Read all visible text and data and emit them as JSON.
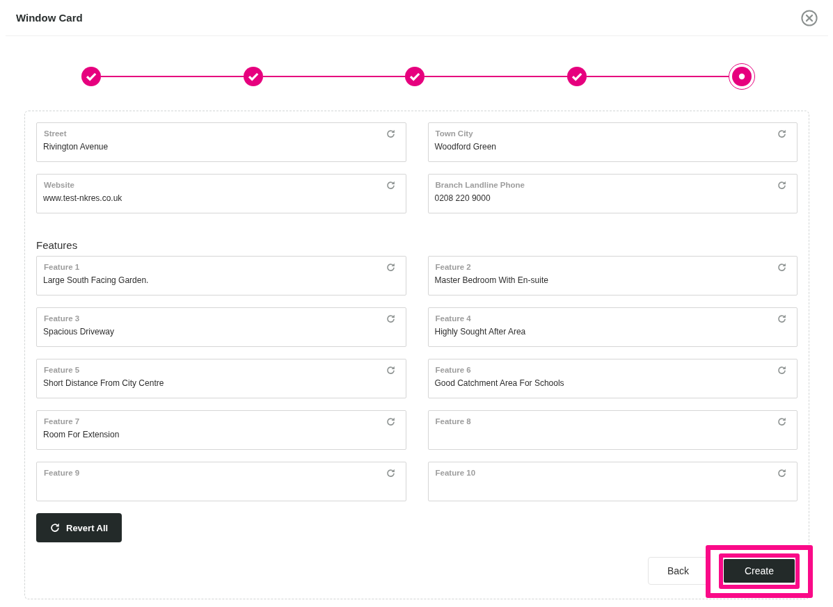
{
  "window": {
    "title": "Window Card"
  },
  "stepper": {
    "steps": [
      {
        "completed": true,
        "selected": false
      },
      {
        "completed": true,
        "selected": false
      },
      {
        "completed": true,
        "selected": false
      },
      {
        "completed": true,
        "selected": false
      },
      {
        "completed": false,
        "selected": true
      }
    ]
  },
  "address_fields": [
    {
      "label": "Street",
      "value": "Rivington Avenue"
    },
    {
      "label": "Town City",
      "value": "Woodford Green"
    },
    {
      "label": "Website",
      "value": "www.test-nkres.co.uk"
    },
    {
      "label": "Branch Landline Phone",
      "value": "0208 220 9000"
    }
  ],
  "features": {
    "heading": "Features",
    "fields": [
      {
        "label": "Feature 1",
        "value": "Large South Facing Garden."
      },
      {
        "label": "Feature 2",
        "value": "Master Bedroom With En-suite"
      },
      {
        "label": "Feature 3",
        "value": "Spacious Driveway"
      },
      {
        "label": "Feature 4",
        "value": "Highly Sought After Area"
      },
      {
        "label": "Feature 5",
        "value": "Short Distance From City Centre"
      },
      {
        "label": "Feature 6",
        "value": "Good Catchment Area For Schools"
      },
      {
        "label": "Feature 7",
        "value": "Room For Extension"
      },
      {
        "label": "Feature 8"
      },
      {
        "label": "Feature 9"
      },
      {
        "label": "Feature 10"
      }
    ]
  },
  "revert_all_button": {
    "label": "Revert All"
  },
  "back_button": {
    "label": "Back"
  },
  "create_button": {
    "label": "Create",
    "highlighted": true
  }
}
